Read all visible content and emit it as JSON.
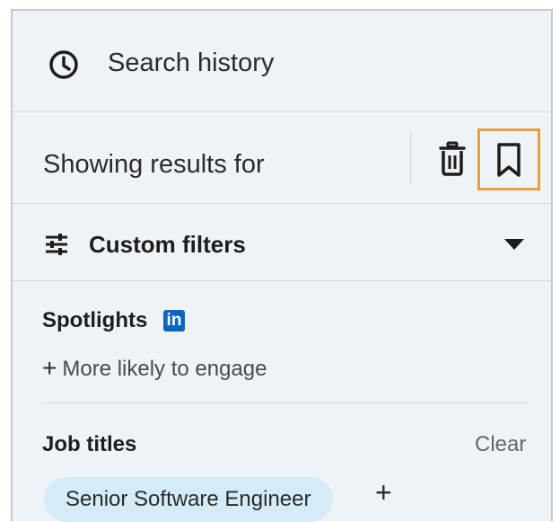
{
  "search_history": {
    "label": "Search history",
    "icon": "clock-icon"
  },
  "results": {
    "label": "Showing results for",
    "delete_icon": "trash-icon",
    "save_icon": "bookmark-icon",
    "highlight_color": "#e5a03a"
  },
  "filters": {
    "label": "Custom filters",
    "icon": "sliders-icon",
    "toggle_icon": "caret-down-icon"
  },
  "spotlights": {
    "title": "Spotlights",
    "badge": "in",
    "badge_color": "#0a66c2",
    "option": "More likely to engage"
  },
  "job_titles": {
    "title": "Job titles",
    "clear_label": "Clear",
    "chips": [
      "Senior Software Engineer"
    ]
  },
  "colors": {
    "panel_bg": "#eef3f8",
    "chip_bg": "#d5ecf8"
  }
}
